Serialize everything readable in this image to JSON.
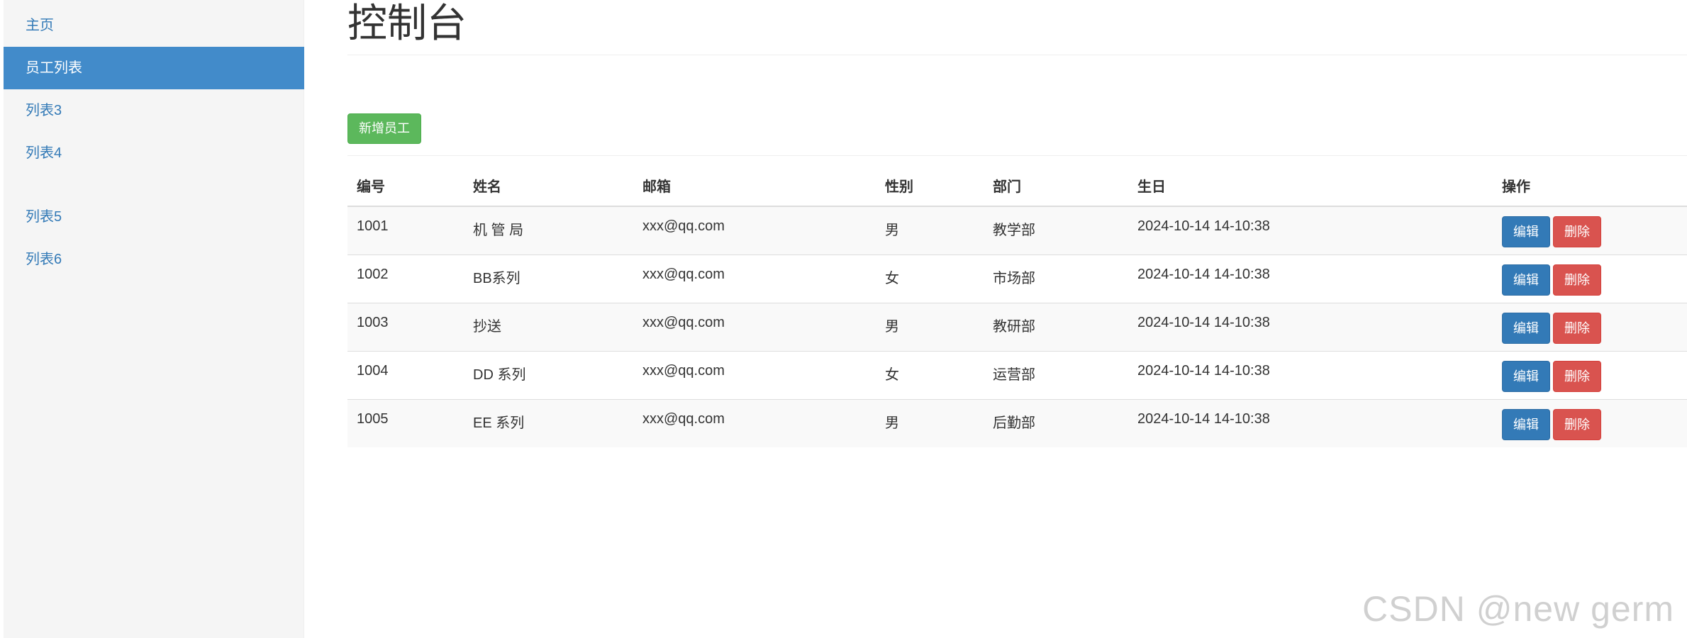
{
  "sidebar": {
    "items": [
      {
        "label": "主页"
      },
      {
        "label": "员工列表"
      },
      {
        "label": "列表3"
      },
      {
        "label": "列表4"
      },
      {
        "label": "列表5"
      },
      {
        "label": "列表6"
      }
    ],
    "active_index": 1
  },
  "main": {
    "title": "控制台",
    "add_button_label": "新增员工"
  },
  "table": {
    "headers": {
      "id": "编号",
      "name": "姓名",
      "email": "邮箱",
      "gender": "性别",
      "department": "部门",
      "birthday": "生日",
      "actions": "操作"
    },
    "rows": [
      {
        "id": "1001",
        "name": "机 管 局",
        "email": "xxx@qq.com",
        "gender": "男",
        "department": "教学部",
        "birthday": "2024-10-14 14-10:38"
      },
      {
        "id": "1002",
        "name": "BB系列",
        "email": "xxx@qq.com",
        "gender": "女",
        "department": "市场部",
        "birthday": "2024-10-14 14-10:38"
      },
      {
        "id": "1003",
        "name": "抄送",
        "email": "xxx@qq.com",
        "gender": "男",
        "department": "教研部",
        "birthday": "2024-10-14 14-10:38"
      },
      {
        "id": "1004",
        "name": "DD 系列",
        "email": "xxx@qq.com",
        "gender": "女",
        "department": "运营部",
        "birthday": "2024-10-14 14-10:38"
      },
      {
        "id": "1005",
        "name": "EE 系列",
        "email": "xxx@qq.com",
        "gender": "男",
        "department": "后勤部",
        "birthday": "2024-10-14 14-10:38"
      }
    ],
    "edit_label": "编辑",
    "delete_label": "删除"
  },
  "watermark": "CSDN @new germ",
  "colors": {
    "sidebar_active": "#428bca",
    "link": "#337ab7",
    "success": "#5cb85c",
    "primary": "#337ab7",
    "danger": "#d9534f"
  }
}
